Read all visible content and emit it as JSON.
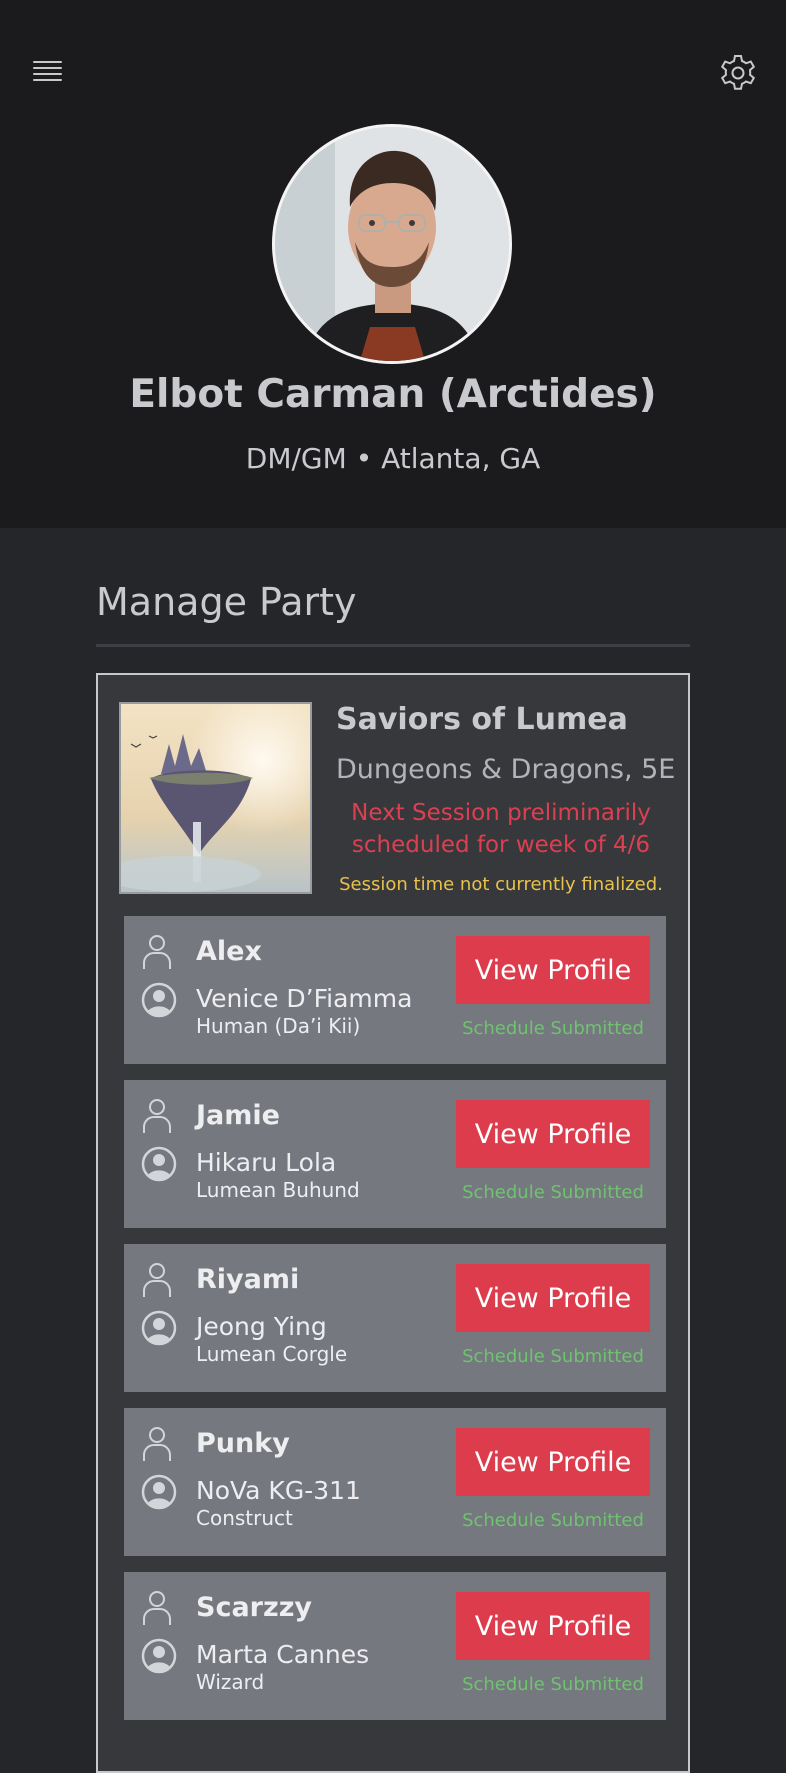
{
  "header": {
    "menu_icon": "hamburger-menu-icon",
    "settings_icon": "gear-icon"
  },
  "profile": {
    "name": "Elbot Carman (Arctides)",
    "subtitle": "DM/GM • Atlanta, GA"
  },
  "section": {
    "title": "Manage Party"
  },
  "party": {
    "name": "Saviors of Lumea",
    "game": "Dungeons & Dragons, 5E",
    "next_session": "Next Session preliminarily scheduled for week of 4/6",
    "session_note": "Session time not currently finalized.",
    "members": [
      {
        "player": "Alex",
        "character": "Venice D’Fiamma",
        "race": "Human (Da’i Kii)",
        "button": "View Profile",
        "status": "Schedule Submitted"
      },
      {
        "player": "Jamie",
        "character": "Hikaru Lola",
        "race": "Lumean Buhund",
        "button": "View Profile",
        "status": "Schedule Submitted"
      },
      {
        "player": "Riyami",
        "character": "Jeong Ying",
        "race": "Lumean Corgle",
        "button": "View Profile",
        "status": "Schedule Submitted"
      },
      {
        "player": "Punky",
        "character": "NoVa KG-311",
        "race": "Construct",
        "button": "View Profile",
        "status": "Schedule Submitted"
      },
      {
        "player": "Scarzzy",
        "character": "Marta Cannes",
        "race": "Wizard",
        "button": "View Profile",
        "status": "Schedule Submitted"
      }
    ]
  },
  "colors": {
    "accent": "#dc3c4c",
    "alert_text": "#dc4050",
    "warning_text": "#e8c24a",
    "success_text": "#6fc36f",
    "header_bg": "#1b1b1e",
    "page_bg": "#25262a",
    "member_bg": "#767880"
  }
}
